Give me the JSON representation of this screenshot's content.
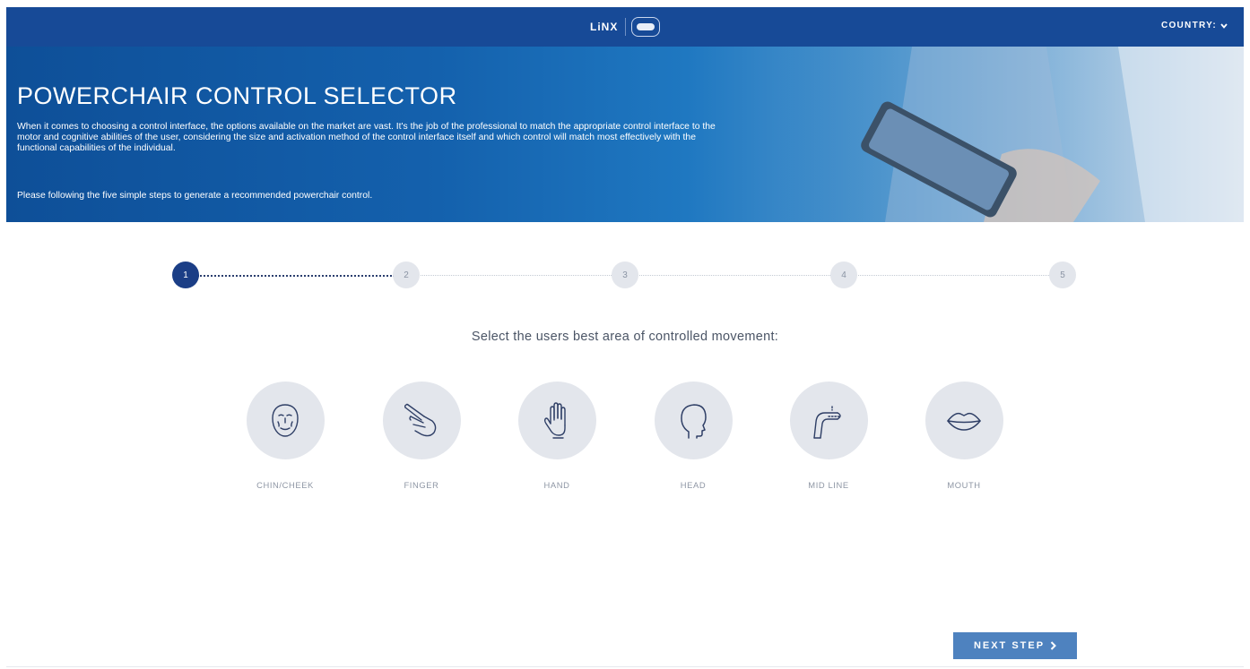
{
  "header": {
    "brand_text": "LiNX",
    "country_label": "COUNTRY:",
    "country_icon": "chevron-down-icon",
    "brand_color": "#174a97"
  },
  "hero": {
    "title": "POWERCHAIR CONTROL SELECTOR",
    "description": "When it comes to choosing a control interface, the options available on the market are vast. It's the job of the professional to match the appropriate control interface to the motor and cognitive abilities of the user, considering the size and activation method of the control interface itself and which control will match most effectively with the functional capabilities of the individual.",
    "instructions": "Please following the five simple steps to generate a recommended powerchair control."
  },
  "stepper": {
    "current": 1,
    "steps": [
      "1",
      "2",
      "3",
      "4",
      "5"
    ],
    "active_color": "#1b3e86"
  },
  "prompt": "Select the users best area of controlled movement:",
  "options": [
    {
      "label": "CHIN/CHEEK",
      "icon": "face-icon"
    },
    {
      "label": "FINGER",
      "icon": "finger-icon"
    },
    {
      "label": "HAND",
      "icon": "hand-icon"
    },
    {
      "label": "HEAD",
      "icon": "head-icon"
    },
    {
      "label": "MID LINE",
      "icon": "knee-icon"
    },
    {
      "label": "MOUTH",
      "icon": "lips-icon"
    }
  ],
  "next_button": {
    "label": "NEXT STEP",
    "icon": "chevron-right-icon",
    "color": "#4e82bf"
  }
}
